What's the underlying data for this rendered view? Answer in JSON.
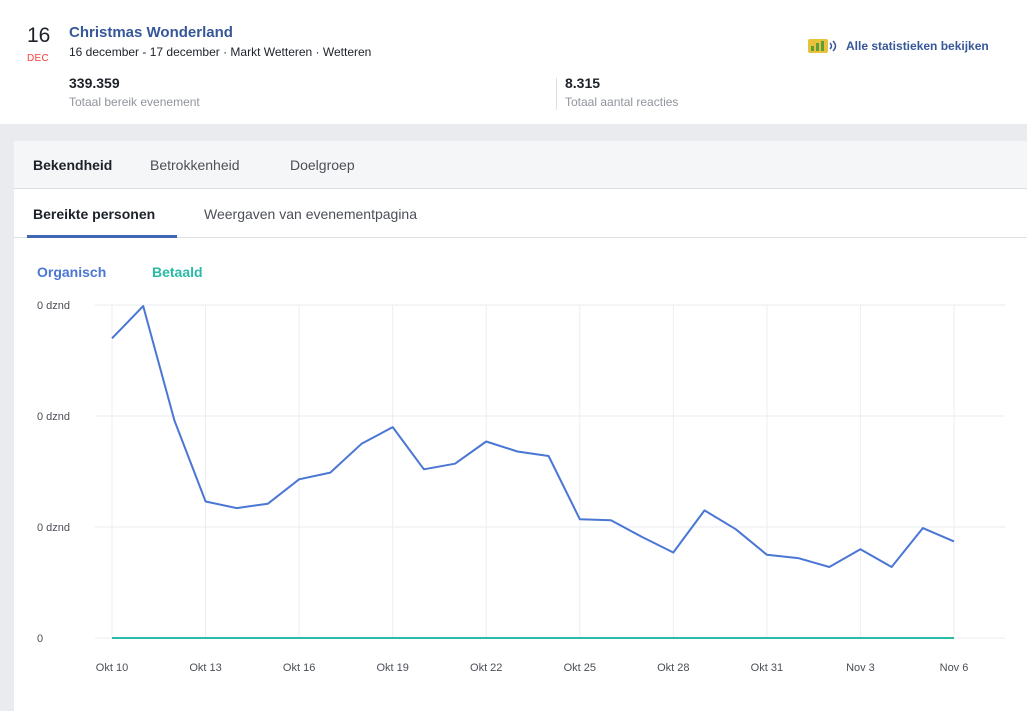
{
  "event": {
    "day": "16",
    "month": "DEC",
    "title": "Christmas Wonderland",
    "subtitle": "16 december - 17 december · Markt Wetteren · Wetteren"
  },
  "stats": [
    {
      "value": "339.359",
      "label": "Totaal bereik evenement"
    },
    {
      "value": "8.315",
      "label": "Totaal aantal reacties"
    }
  ],
  "all_stats_link": {
    "label": "Alle statistieken bekijken",
    "icon": "chart-icon"
  },
  "tabs": {
    "main": [
      {
        "label": "Bekendheid",
        "active": true
      },
      {
        "label": "Betrokkenheid",
        "active": false
      },
      {
        "label": "Doelgroep",
        "active": false
      }
    ],
    "sub": [
      {
        "label": "Bereikte personen",
        "active": true
      },
      {
        "label": "Weergaven van evenementpagina",
        "active": false
      }
    ]
  },
  "legend": {
    "organic": {
      "label": "Organisch",
      "color": "#4a76d4"
    },
    "paid": {
      "label": "Betaald",
      "color": "#2abba7"
    }
  },
  "chart_data": {
    "type": "line",
    "title": "",
    "xlabel": "",
    "ylabel": "",
    "x_tick_labels": [
      "Okt 10",
      "Okt 13",
      "Okt 16",
      "Okt 19",
      "Okt 22",
      "Okt 25",
      "Okt 28",
      "Okt 31",
      "Nov 3",
      "Nov 6"
    ],
    "x_tick_positions": [
      0,
      3,
      6,
      9,
      12,
      15,
      18,
      21,
      24,
      27
    ],
    "y_tick_labels": [
      "0",
      "0 dznd",
      "0 dznd",
      "0 dznd"
    ],
    "y_tick_values": [
      0,
      1,
      2,
      3
    ],
    "ylim": [
      0,
      3
    ],
    "grid": true,
    "x": [
      "Okt 10",
      "Okt 11",
      "Okt 12",
      "Okt 13",
      "Okt 14",
      "Okt 15",
      "Okt 16",
      "Okt 17",
      "Okt 18",
      "Okt 19",
      "Okt 20",
      "Okt 21",
      "Okt 22",
      "Okt 23",
      "Okt 24",
      "Okt 25",
      "Okt 26",
      "Okt 27",
      "Okt 28",
      "Okt 29",
      "Okt 30",
      "Okt 31",
      "Nov 1",
      "Nov 2",
      "Nov 3",
      "Nov 4",
      "Nov 5",
      "Nov 6"
    ],
    "series": [
      {
        "name": "Organisch",
        "color": "#4a76d4",
        "values": [
          2.7,
          2.99,
          1.96,
          1.23,
          1.17,
          1.21,
          1.43,
          1.49,
          1.75,
          1.9,
          1.52,
          1.57,
          1.77,
          1.68,
          1.64,
          1.07,
          1.06,
          0.91,
          0.77,
          1.15,
          0.98,
          0.75,
          0.72,
          0.64,
          0.8,
          0.64,
          0.99,
          0.87
        ]
      },
      {
        "name": "Betaald",
        "color": "#2abba7",
        "values": [
          0,
          0,
          0,
          0,
          0,
          0,
          0,
          0,
          0,
          0,
          0,
          0,
          0,
          0,
          0,
          0,
          0,
          0,
          0,
          0,
          0,
          0,
          0,
          0,
          0,
          0,
          0,
          0
        ]
      }
    ]
  }
}
